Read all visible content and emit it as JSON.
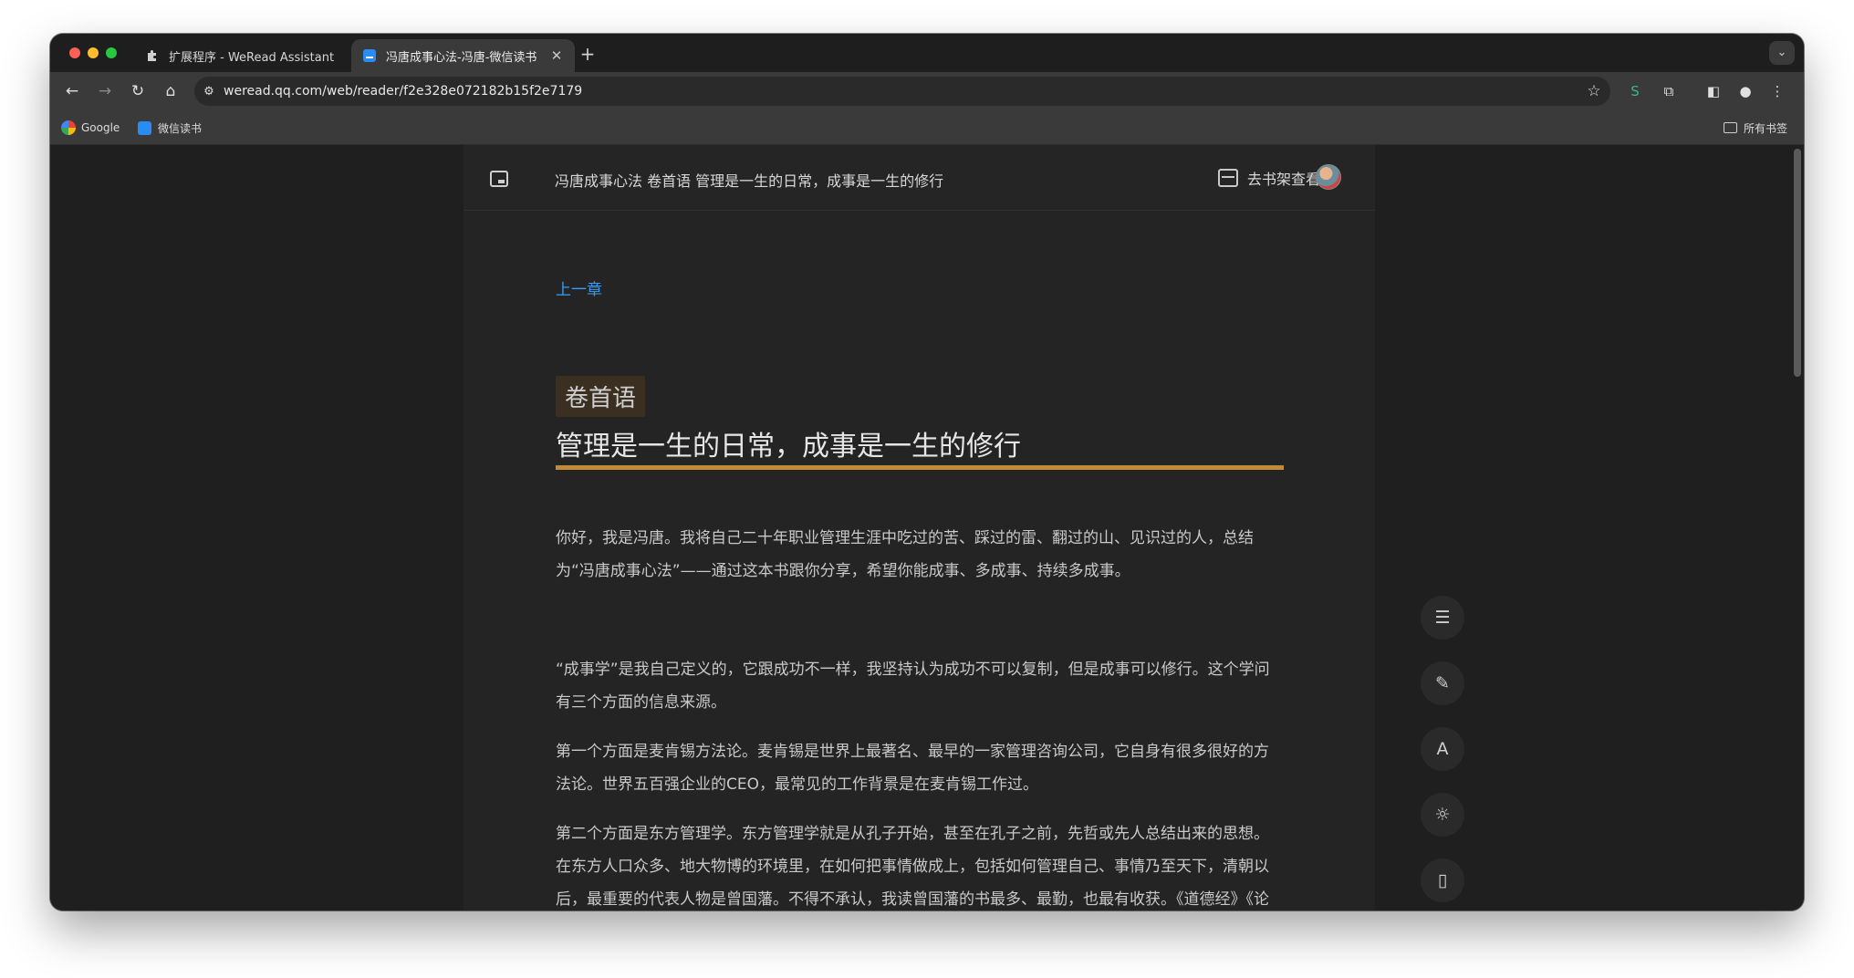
{
  "browser": {
    "tabs": [
      {
        "title": "扩展程序 - WeRead Assistant",
        "icon": "puzzle-icon",
        "active": false
      },
      {
        "title": "冯唐成事心法-冯唐-微信读书",
        "icon": "weread-icon",
        "active": true
      }
    ],
    "url": "weread.qq.com/web/reader/f2e328e072182b15f2e7179",
    "bookmarks": [
      "Google",
      "微信读书"
    ],
    "bookmarks_folder": "所有书签"
  },
  "reader": {
    "header_title": "冯唐成事心法 卷首语 管理是一生的日常，成事是一生的修行",
    "shelf_label": "去书架查看",
    "prev_chapter": "上一章",
    "volume_tag": "卷首语",
    "chapter_title": "管理是一生的日常，成事是一生的修行",
    "accent_color": "#c08a37",
    "link_color": "#3a9cf5",
    "paragraphs": [
      "你好，我是冯唐。我将自己二十年职业管理生涯中吃过的苦、踩过的雷、翻过的山、见识过的人，总结为“冯唐成事心法”——通过这本书跟你分享，希望你能成事、多成事、持续多成事。",
      "“成事学”是我自己定义的，它跟成功不一样，我坚持认为成功不可以复制，但是成事可以修行。这个学问有三个方面的信息来源。",
      "第一个方面是麦肯锡方法论。麦肯锡是世界上最著名、最早的一家管理咨询公司，它自身有很多很好的方法论。世界五百强企业的CEO，最常见的工作背景是在麦肯锡工作过。",
      "第二个方面是东方管理学。东方管理学就是从孔子开始，甚至在孔子之前，先哲或先人总结出来的思想。在东方人口众多、地大物博的环境里，在如何把事情做成上，包括如何管理自己、事情乃至天下，清朝以后，最重要的代表人物是曾国藩。不得不承认，我读曾国藩的书最多、最勤，也最有收获。《道德经》《论语》的年代太久远了，《二十四史》《资治通鉴》都是很好的书，但太冗长了，"
    ],
    "side_tools": [
      "toc-icon",
      "note-icon",
      "font-icon",
      "brightness-icon",
      "phone-icon"
    ]
  }
}
